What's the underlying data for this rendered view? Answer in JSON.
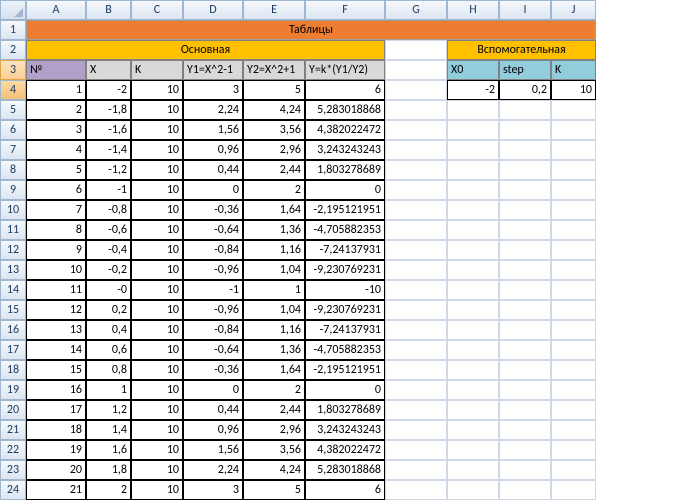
{
  "columns": [
    "A",
    "B",
    "C",
    "D",
    "E",
    "F",
    "G",
    "H",
    "I",
    "J"
  ],
  "row_headers": [
    "1",
    "2",
    "3",
    "4",
    "5",
    "6",
    "7",
    "8",
    "9",
    "10",
    "11",
    "12",
    "13",
    "14",
    "15",
    "16",
    "17",
    "18",
    "19",
    "20",
    "21",
    "22",
    "23",
    "24"
  ],
  "title_row": "Таблицы",
  "main_header": "Основная",
  "aux_header": "Вспомогательная",
  "main_cols": {
    "no": "№",
    "x": "X",
    "k": "K",
    "y1": "Y1=X^2-1",
    "y2": "Y2=X^2+1",
    "y": "Y=k*(Y1/Y2)"
  },
  "aux_cols": {
    "x0": "X0",
    "step": "step",
    "k": "K"
  },
  "aux_values": {
    "x0": "-2",
    "step": "0,2",
    "k": "10"
  },
  "rows": [
    {
      "no": "1",
      "x": "-2",
      "k": "10",
      "y1": "3",
      "y2": "5",
      "y": "6"
    },
    {
      "no": "2",
      "x": "-1,8",
      "k": "10",
      "y1": "2,24",
      "y2": "4,24",
      "y": "5,283018868"
    },
    {
      "no": "3",
      "x": "-1,6",
      "k": "10",
      "y1": "1,56",
      "y2": "3,56",
      "y": "4,382022472"
    },
    {
      "no": "4",
      "x": "-1,4",
      "k": "10",
      "y1": "0,96",
      "y2": "2,96",
      "y": "3,243243243"
    },
    {
      "no": "5",
      "x": "-1,2",
      "k": "10",
      "y1": "0,44",
      "y2": "2,44",
      "y": "1,803278689"
    },
    {
      "no": "6",
      "x": "-1",
      "k": "10",
      "y1": "0",
      "y2": "2",
      "y": "0"
    },
    {
      "no": "7",
      "x": "-0,8",
      "k": "10",
      "y1": "-0,36",
      "y2": "1,64",
      "y": "-2,195121951"
    },
    {
      "no": "8",
      "x": "-0,6",
      "k": "10",
      "y1": "-0,64",
      "y2": "1,36",
      "y": "-4,705882353"
    },
    {
      "no": "9",
      "x": "-0,4",
      "k": "10",
      "y1": "-0,84",
      "y2": "1,16",
      "y": "-7,24137931"
    },
    {
      "no": "10",
      "x": "-0,2",
      "k": "10",
      "y1": "-0,96",
      "y2": "1,04",
      "y": "-9,230769231"
    },
    {
      "no": "11",
      "x": "-0",
      "k": "10",
      "y1": "-1",
      "y2": "1",
      "y": "-10"
    },
    {
      "no": "12",
      "x": "0,2",
      "k": "10",
      "y1": "-0,96",
      "y2": "1,04",
      "y": "-9,230769231"
    },
    {
      "no": "13",
      "x": "0,4",
      "k": "10",
      "y1": "-0,84",
      "y2": "1,16",
      "y": "-7,24137931"
    },
    {
      "no": "14",
      "x": "0,6",
      "k": "10",
      "y1": "-0,64",
      "y2": "1,36",
      "y": "-4,705882353"
    },
    {
      "no": "15",
      "x": "0,8",
      "k": "10",
      "y1": "-0,36",
      "y2": "1,64",
      "y": "-2,195121951"
    },
    {
      "no": "16",
      "x": "1",
      "k": "10",
      "y1": "0",
      "y2": "2",
      "y": "0"
    },
    {
      "no": "17",
      "x": "1,2",
      "k": "10",
      "y1": "0,44",
      "y2": "2,44",
      "y": "1,803278689"
    },
    {
      "no": "18",
      "x": "1,4",
      "k": "10",
      "y1": "0,96",
      "y2": "2,96",
      "y": "3,243243243"
    },
    {
      "no": "19",
      "x": "1,6",
      "k": "10",
      "y1": "1,56",
      "y2": "3,56",
      "y": "4,382022472"
    },
    {
      "no": "20",
      "x": "1,8",
      "k": "10",
      "y1": "2,24",
      "y2": "4,24",
      "y": "5,283018868"
    },
    {
      "no": "21",
      "x": "2",
      "k": "10",
      "y1": "3",
      "y2": "5",
      "y": "6"
    }
  ]
}
